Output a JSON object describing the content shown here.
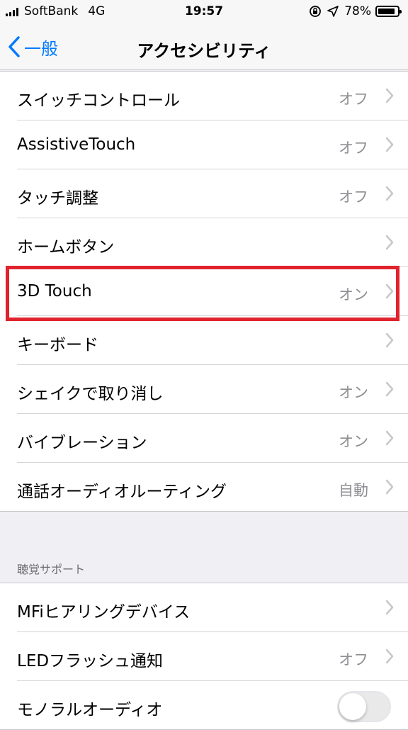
{
  "status_bar": {
    "carrier": "SoftBank",
    "network": "4G",
    "time": "19:57",
    "battery": "78%",
    "battery_level": 0.78
  },
  "nav": {
    "back_label": "一般",
    "title": "アクセシビリティ"
  },
  "groups": [
    {
      "rows": [
        {
          "label": "スイッチコントロール",
          "value": "オフ"
        },
        {
          "label": "AssistiveTouch",
          "value": "オフ"
        },
        {
          "label": "タッチ調整",
          "value": "オフ"
        },
        {
          "label": "ホームボタン",
          "value": ""
        },
        {
          "label": "3D Touch",
          "value": "オン"
        },
        {
          "label": "キーボード",
          "value": ""
        },
        {
          "label": "シェイクで取り消し",
          "value": "オン"
        },
        {
          "label": "バイブレーション",
          "value": "オン"
        },
        {
          "label": "通話オーディオルーティング",
          "value": "自動"
        }
      ]
    },
    {
      "header": "聴覚サポート",
      "rows": [
        {
          "label": "MFiヒアリングデバイス",
          "value": ""
        },
        {
          "label": "LEDフラッシュ通知",
          "value": "オフ"
        },
        {
          "label": "モノラルオーディオ",
          "toggle": false
        }
      ]
    }
  ],
  "colors": {
    "accent": "#007aff",
    "highlight": "#e0232d",
    "secondary_text": "#8e8e93"
  }
}
